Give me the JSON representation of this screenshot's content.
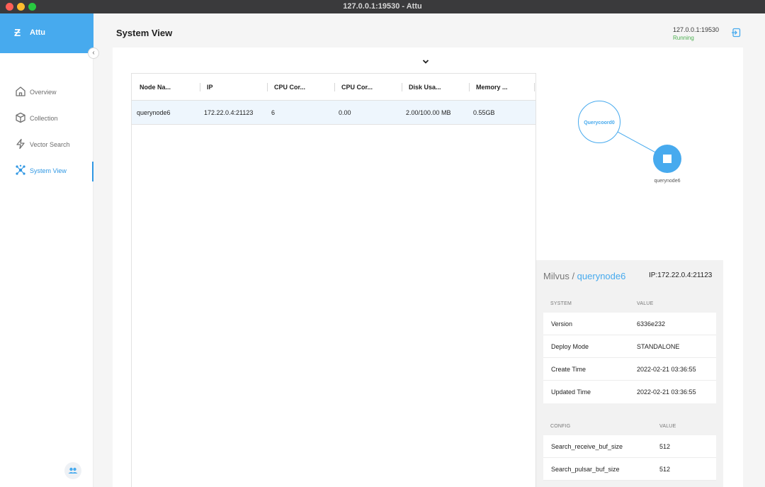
{
  "window": {
    "title": "127.0.0.1:19530 - Attu"
  },
  "app": {
    "name": "Attu",
    "logo_glyph": "Ƶ",
    "accent_color": "#47aaee"
  },
  "sidebar": {
    "items": [
      {
        "label": "Overview",
        "icon": "home-icon",
        "active": false
      },
      {
        "label": "Collection",
        "icon": "cube-icon",
        "active": false
      },
      {
        "label": "Vector Search",
        "icon": "lightning-icon",
        "active": false
      },
      {
        "label": "System View",
        "icon": "cluster-icon",
        "active": true
      }
    ],
    "collapse_glyph": "‹"
  },
  "header": {
    "title": "System View",
    "server_address": "127.0.0.1:19530",
    "server_status": "Running",
    "status_color": "#4caf50"
  },
  "table": {
    "columns": [
      "Node Na...",
      "IP",
      "CPU Cor...",
      "CPU Cor...",
      "Disk Usa...",
      "Memory ..."
    ],
    "rows": [
      {
        "node_name": "querynode6",
        "ip": "172.22.0.4:21123",
        "cpu_cores": "6",
        "cpu_core_usage": "0.00",
        "disk_usage": "2.00/100.00 MB",
        "memory": "0.55GB"
      }
    ]
  },
  "topology": {
    "coordinator": "Querycoord0",
    "node": "querynode6"
  },
  "detail": {
    "prefix": "Milvus / ",
    "node_name": "querynode6",
    "ip_label": "IP:172.22.0.4:21123",
    "system": {
      "header_key": "SYSTEM",
      "header_value": "VALUE",
      "rows": [
        {
          "key": "Version",
          "value": "6336e232"
        },
        {
          "key": "Deploy Mode",
          "value": "STANDALONE"
        },
        {
          "key": "Create Time",
          "value": "2022-02-21 03:36:55"
        },
        {
          "key": "Updated Time",
          "value": "2022-02-21 03:36:55"
        }
      ]
    },
    "config": {
      "header_key": "CONFIG",
      "header_value": "VALUE",
      "rows": [
        {
          "key": "Search_receive_buf_size",
          "value": "512"
        },
        {
          "key": "Search_pulsar_buf_size",
          "value": "512"
        }
      ]
    }
  }
}
